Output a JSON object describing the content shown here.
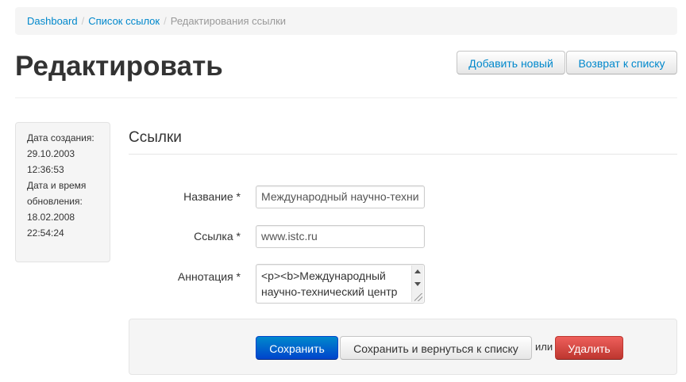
{
  "breadcrumb": {
    "items": [
      "Dashboard",
      "Список ссылок"
    ],
    "separator": "/",
    "active": "Редактирования ссылки"
  },
  "header": {
    "title": "Редактировать",
    "add_new_label": "Добавить новый",
    "back_to_list_label": "Возврат к списку"
  },
  "info": {
    "created_label": "Дата создания:",
    "created_date": "29.10.2003",
    "created_time": "12:36:53",
    "updated_label": "Дата и время обновления:",
    "updated_date": "18.02.2008",
    "updated_time": "22:54:24"
  },
  "form": {
    "legend": "Ссылки",
    "fields": [
      {
        "label": "Название *",
        "value": "Международный научно-техни"
      },
      {
        "label": "Ссылка *",
        "value": "www.istc.ru"
      },
      {
        "label": "Аннотация *",
        "value_line1": "<p><b>Международный",
        "value_line2": "научно-технический центр"
      }
    ]
  },
  "actions": {
    "save_label": "Сохранить",
    "save_and_back_label": "Сохранить и вернуться к списку",
    "or_text": "или",
    "delete_label": "Удалить"
  },
  "colors": {
    "link": "#0088cc",
    "primary": "#0088cc",
    "danger": "#da4f49",
    "well_bg": "#f5f5f5"
  }
}
